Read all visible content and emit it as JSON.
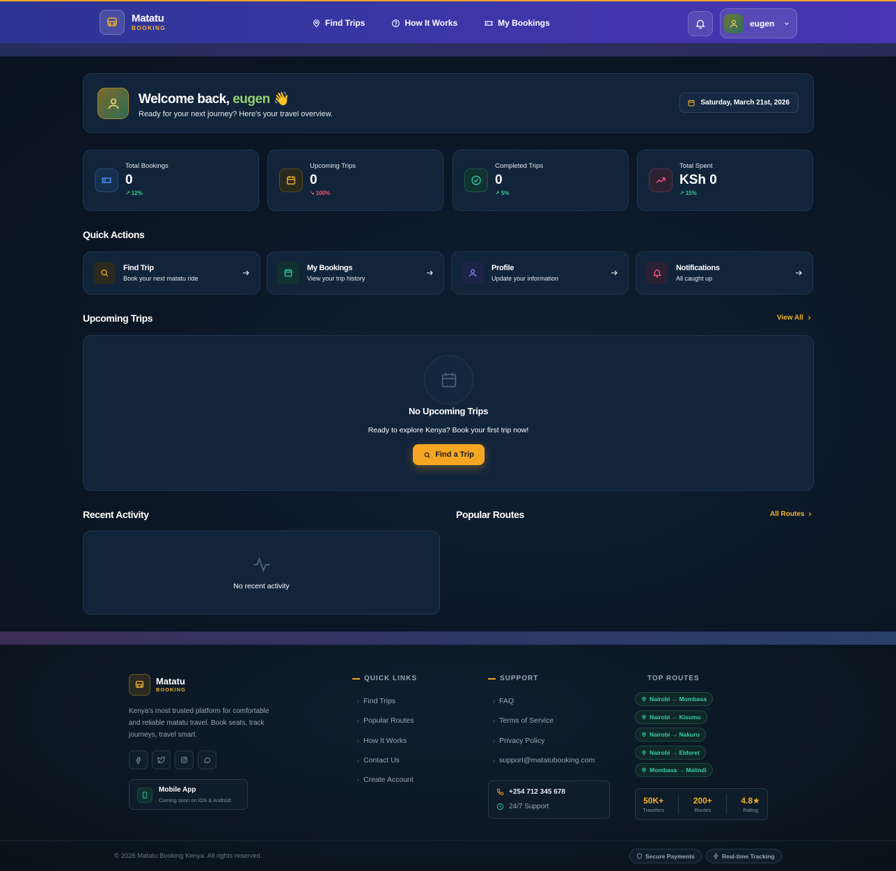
{
  "header": {
    "brand_name": "Matatu",
    "brand_sub": "BOOKING",
    "nav": [
      {
        "label": "Find Trips",
        "icon": "map-pin-icon"
      },
      {
        "label": "How It Works",
        "icon": "help-circle-icon"
      },
      {
        "label": "My Bookings",
        "icon": "ticket-icon"
      }
    ],
    "user_name": "eugen"
  },
  "welcome": {
    "greeting": "Welcome back,",
    "name": "eugen",
    "emoji": "👋",
    "subtitle": "Ready for your next journey? Here's your travel overview.",
    "date": "Saturday, March 21st, 2026"
  },
  "stats": [
    {
      "label": "Total Bookings",
      "value": "0",
      "trend": "12%",
      "direction": "up",
      "icon": "ticket-icon",
      "color": "#4c8dff"
    },
    {
      "label": "Upcoming Trips",
      "value": "0",
      "trend": "100%",
      "direction": "down",
      "icon": "calendar-icon",
      "color": "#f5b32a"
    },
    {
      "label": "Completed Trips",
      "value": "0",
      "trend": "5%",
      "direction": "up",
      "icon": "check-circle-icon",
      "color": "#2fd4b0"
    },
    {
      "label": "Total Spent",
      "value": "KSh 0",
      "trend": "15%",
      "direction": "up",
      "icon": "trending-up-icon",
      "color": "#ff5a8a"
    }
  ],
  "quick_actions": {
    "title": "Quick Actions",
    "items": [
      {
        "title": "Find Trip",
        "subtitle": "Book your next matatu ride",
        "icon": "search-icon",
        "color": "#f5b32a"
      },
      {
        "title": "My Bookings",
        "subtitle": "View your trip history",
        "icon": "calendar-icon",
        "color": "#2fd4b0"
      },
      {
        "title": "Profile",
        "subtitle": "Update your information",
        "icon": "user-icon",
        "color": "#7f8bff"
      },
      {
        "title": "Notifications",
        "subtitle": "All caught up",
        "icon": "bell-icon",
        "color": "#ff5a8a"
      }
    ]
  },
  "upcoming": {
    "title": "Upcoming Trips",
    "view_all": "View All",
    "empty_title": "No Upcoming Trips",
    "empty_sub": "Ready to explore Kenya? Book your first trip now!",
    "cta": "Find a Trip"
  },
  "activity": {
    "title": "Recent Activity",
    "empty": "No recent activity"
  },
  "popular": {
    "title": "Popular Routes",
    "all_routes": "All Routes"
  },
  "footer": {
    "brand_name": "Matatu",
    "brand_sub": "BOOKING",
    "description": "Kenya's most trusted platform for comfortable and reliable matatu travel. Book seats, track journeys, travel smart.",
    "mobile_app_title": "Mobile App",
    "mobile_app_sub": "Coming soon on iOS & Android",
    "quick_links_title": "QUICK LINKS",
    "quick_links": [
      "Find Trips",
      "Popular Routes",
      "How It Works",
      "Contact Us",
      "Create Account"
    ],
    "support_title": "SUPPORT",
    "support_links": [
      "FAQ",
      "Terms of Service",
      "Privacy Policy",
      "support@matatubooking.com"
    ],
    "phone": "+254 712 345 678",
    "support_hours": "24/7 Support",
    "top_routes_title": "TOP ROUTES",
    "top_routes": [
      "Nairobi → Mombasa",
      "Nairobi → Kisumu",
      "Nairobi → Nakuru",
      "Nairobi → Eldoret",
      "Mombasa → Malindi"
    ],
    "stats": [
      {
        "value": "50K+",
        "label": "Travelers"
      },
      {
        "value": "200+",
        "label": "Routes"
      },
      {
        "value": "4.8★",
        "label": "Rating"
      }
    ],
    "copyright": "© 2026 Matatu Booking Kenya. All rights reserved.",
    "badges": [
      "Secure Payments",
      "Real-time Tracking"
    ]
  }
}
